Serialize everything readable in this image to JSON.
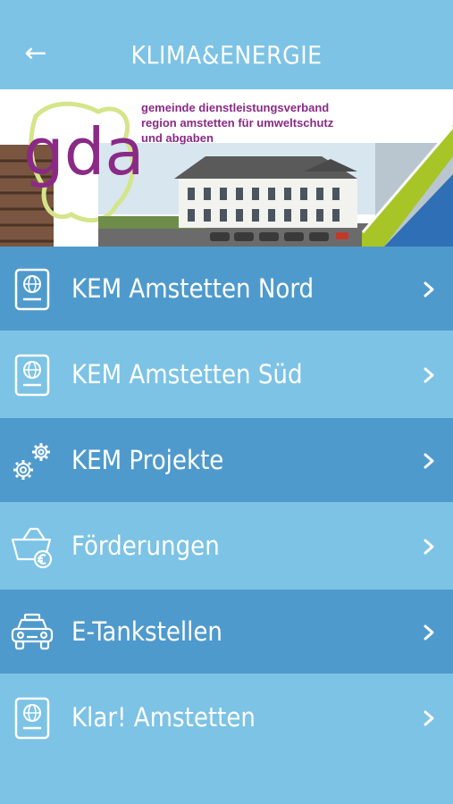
{
  "header": {
    "title": "KLIMA&ENERGIE",
    "back_icon": "←"
  },
  "banner": {
    "logo_text": "gda",
    "lines": [
      "gemeinde dienstleistungsverband",
      "region amstetten für umweltschutz",
      "und abgaben"
    ],
    "brand_color": "#8a2a86",
    "accent_color": "#a7c526"
  },
  "menu": {
    "items": [
      {
        "label": "KEM Amstetten Nord",
        "icon": "passport-globe-icon"
      },
      {
        "label": "KEM Amstetten Süd",
        "icon": "passport-globe-icon"
      },
      {
        "label": "KEM Projekte",
        "icon": "gears-icon"
      },
      {
        "label": "Förderungen",
        "icon": "basket-euro-icon"
      },
      {
        "label": "E-Tankstellen",
        "icon": "taxi-car-icon"
      },
      {
        "label": "Klar! Amstetten",
        "icon": "passport-globe-icon"
      }
    ]
  },
  "colors": {
    "background": "#7cc3e6",
    "row_dark": "#4f9acc",
    "text": "#ffffff"
  }
}
